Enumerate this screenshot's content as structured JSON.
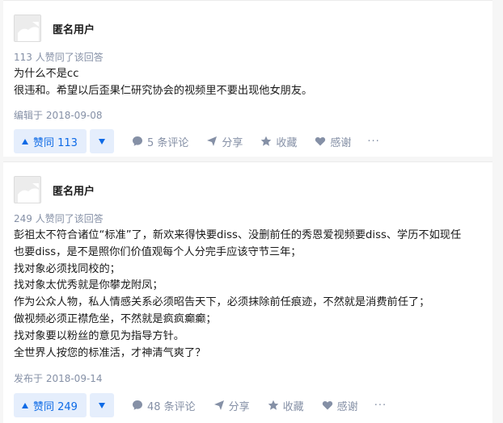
{
  "answers": [
    {
      "author": "匿名用户",
      "vote_summary": "113 人赞同了该回答",
      "content": [
        "为什么不是cc",
        "很违和。希望以后歪果仁研究协会的视频里不要出现他女朋友。"
      ],
      "date": "编辑于 2018-09-08",
      "upvote_label": "赞同 113",
      "comments_label": "5 条评论",
      "share_label": "分享",
      "favorite_label": "收藏",
      "thanks_label": "感谢",
      "more_label": "···"
    },
    {
      "author": "匿名用户",
      "vote_summary": "249 人赞同了该回答",
      "content": [
        "彭祖太不符合诸位“标准”了，新欢来得快要diss、没删前任的秀恩爱视频要diss、学历不如现任",
        "也要diss，是不是照你们价值观每个人分完手应该守节三年；",
        "找对象必须找同校的；",
        "找对象太优秀就是你攀龙附凤；",
        "作为公众人物，私人情感关系必须昭告天下，必须抹除前任痕迹，不然就是消费前任了；",
        "做视频必须正襟危坐，不然就是疯疯癫癫；",
        "找对象要以粉丝的意见为指导方针。",
        "全世界人按您的标准活，才神清气爽了？"
      ],
      "date": "发布于 2018-09-14",
      "upvote_label": "赞同 249",
      "comments_label": "48 条评论",
      "share_label": "分享",
      "favorite_label": "收藏",
      "thanks_label": "感谢",
      "more_label": "···"
    }
  ],
  "icons": {
    "upvote": "triangle-up-icon",
    "downvote": "triangle-down-icon",
    "comment": "comment-bubble-icon",
    "share": "paper-plane-icon",
    "favorite": "star-icon",
    "thanks": "heart-icon",
    "more": "ellipsis-icon"
  },
  "colors": {
    "accent": "#0d6ae6",
    "accent_bg": "#e5eefc",
    "meta": "#8590a6"
  }
}
